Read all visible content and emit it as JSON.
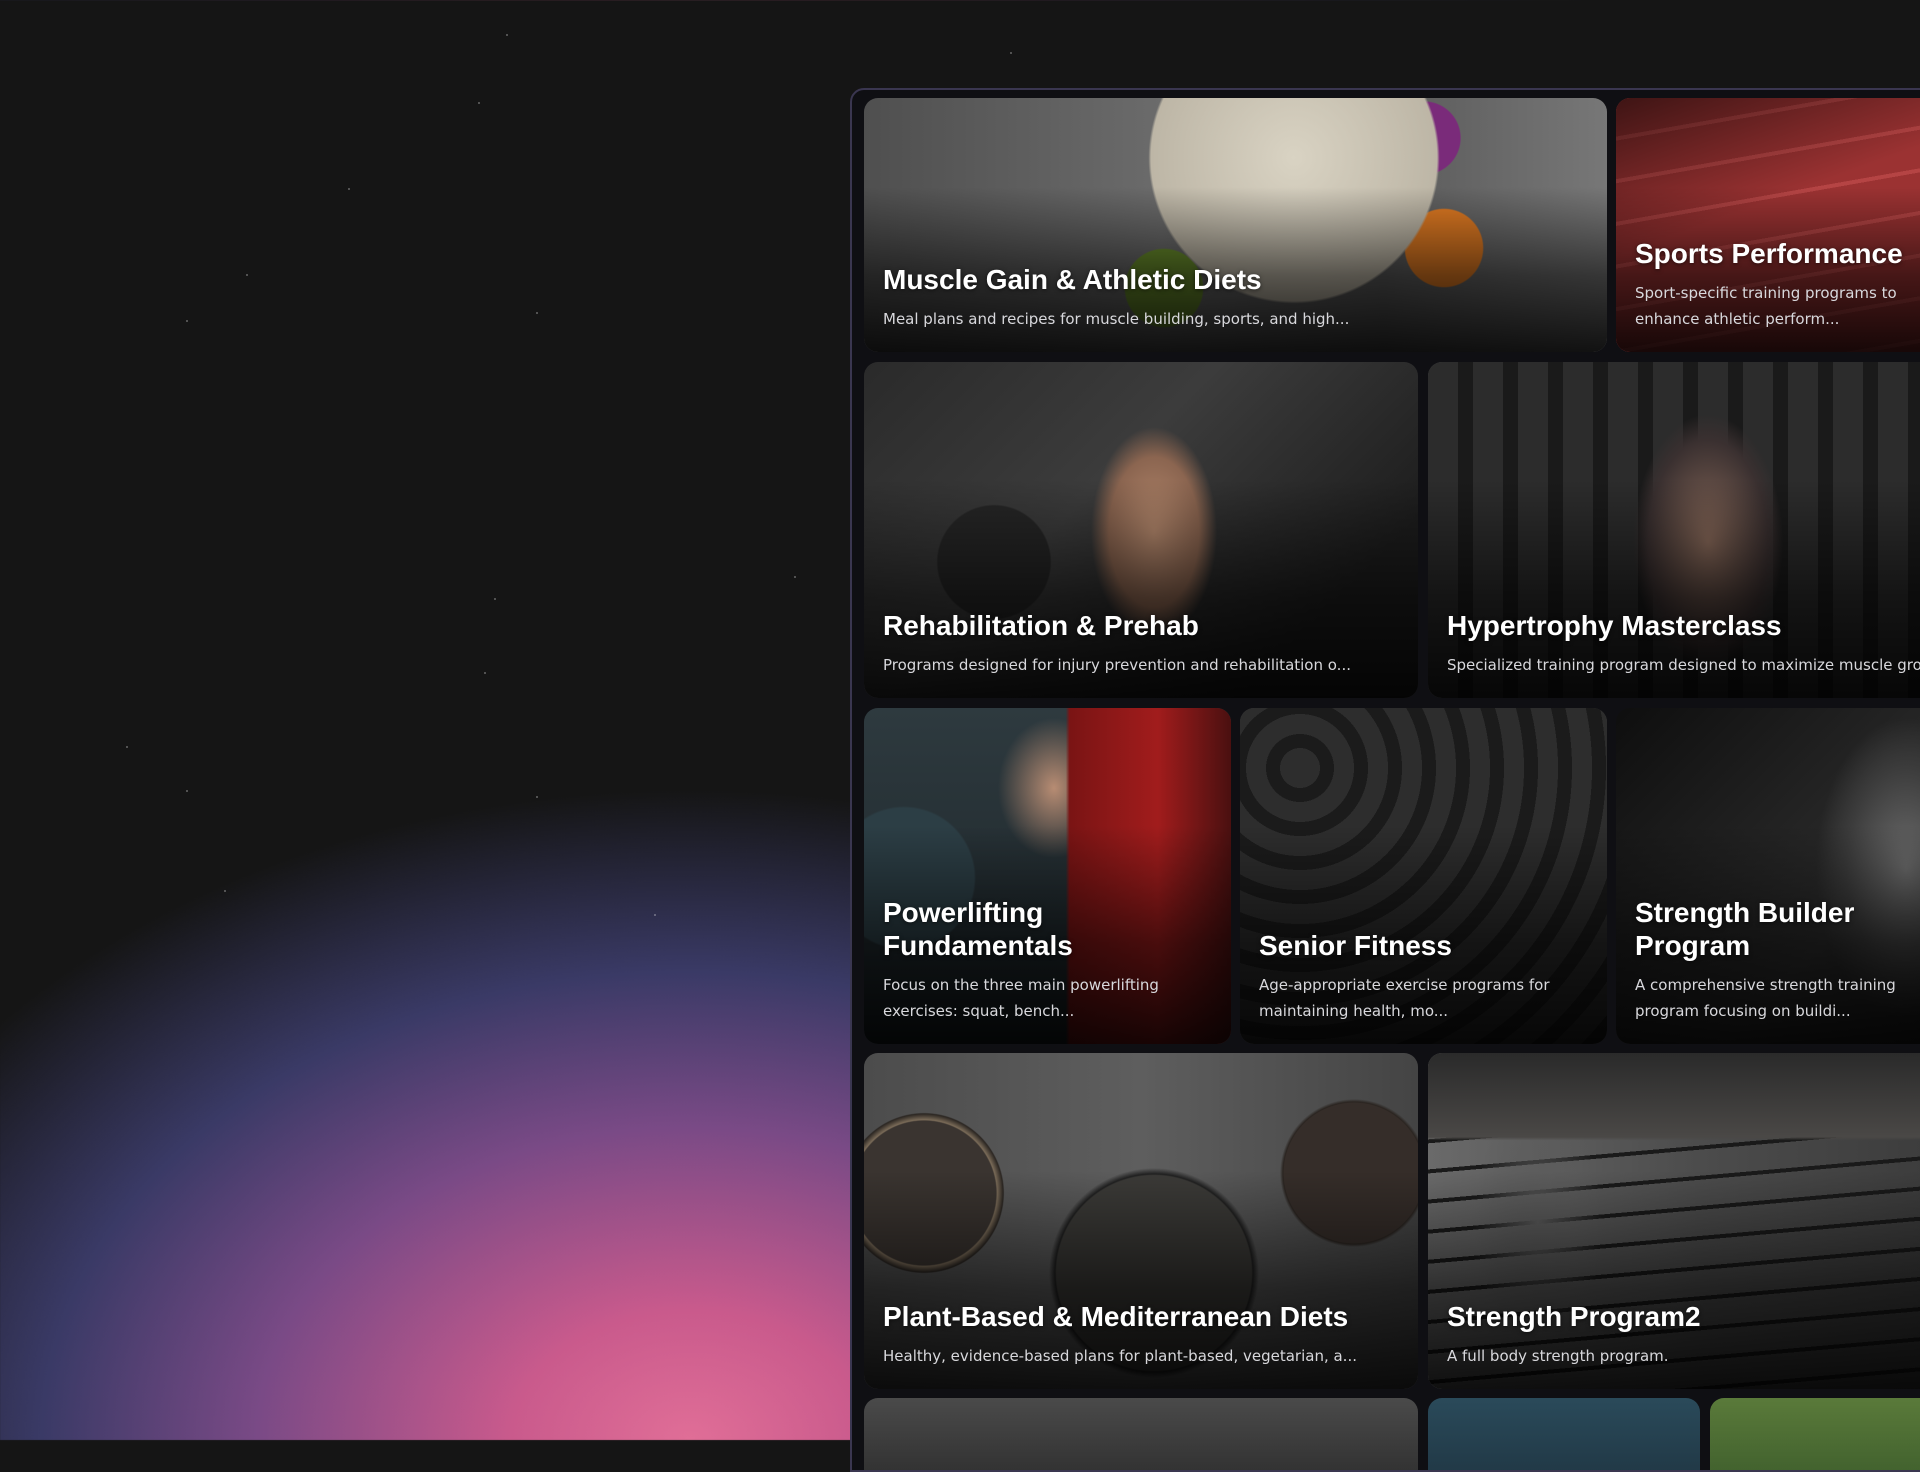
{
  "cards": [
    {
      "title": "Muscle Gain & Athletic Diets",
      "desc": "Meal plans and recipes for muscle building, sports, and high..."
    },
    {
      "title": "Sports Performance",
      "desc": "Sport-specific training programs to enhance athletic perform..."
    },
    {
      "title": "Rehabilitation & Prehab",
      "desc": "Programs designed for injury prevention and rehabilitation o..."
    },
    {
      "title": "Hypertrophy Masterclass",
      "desc": "Specialized training program designed to maximize muscle gro..."
    },
    {
      "title": "Powerlifting Fundamentals",
      "desc": "Focus on the three main powerlifting exercises: squat, bench..."
    },
    {
      "title": "Senior Fitness",
      "desc": "Age-appropriate exercise programs for maintaining health, mo..."
    },
    {
      "title": "Strength Builder Program",
      "desc": "A comprehensive strength training program focusing on buildi..."
    },
    {
      "title": "Plant-Based & Mediterranean Diets",
      "desc": "Healthy, evidence-based plans for plant-based, vegetarian, a..."
    },
    {
      "title": "Strength Program2",
      "desc": "A full body strength program."
    }
  ]
}
